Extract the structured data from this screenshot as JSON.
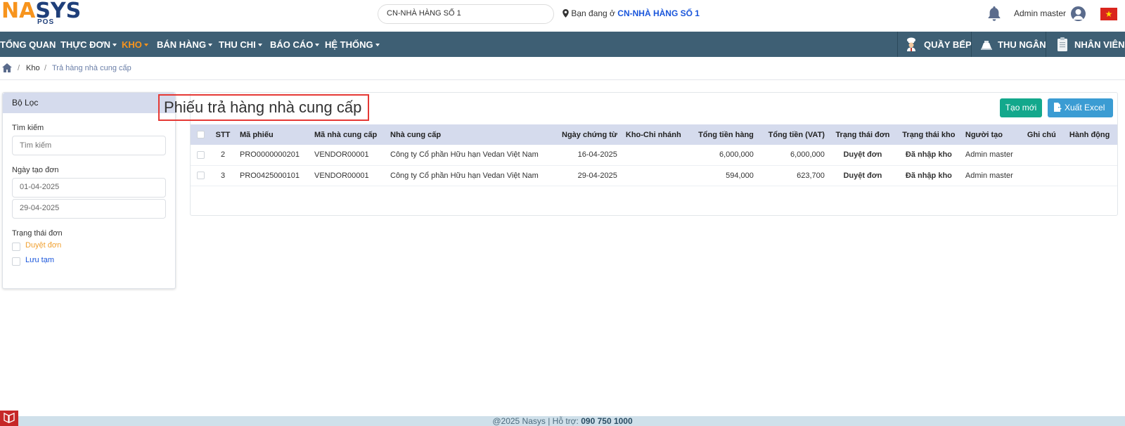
{
  "header": {
    "logo_main_na": "NA",
    "logo_main_sys": "SYS",
    "logo_sub": "POS",
    "branch_select_value": "CN-NHÀ HÀNG SỐ 1",
    "location_prefix": "Bạn đang ở",
    "location_branch": "CN-NHÀ HÀNG SỐ 1",
    "user_name": "Admin master",
    "flag_star": "★"
  },
  "nav": {
    "items": [
      {
        "label": "TỔNG QUAN"
      },
      {
        "label": "THỰC ĐƠN"
      },
      {
        "label": "KHO"
      },
      {
        "label": "BÁN HÀNG"
      },
      {
        "label": "THU CHI"
      },
      {
        "label": "BÁO CÁO"
      },
      {
        "label": "HỆ THỐNG"
      }
    ],
    "right": [
      {
        "label": "QUẦY BẾP"
      },
      {
        "label": "THU NGÂN"
      },
      {
        "label": "NHÂN VIÊN"
      }
    ],
    "active_color": "#f7941d"
  },
  "breadcrumb": {
    "sep": "/",
    "kho": "Kho",
    "current": "Trả hàng nhà cung cấp"
  },
  "filter": {
    "title": "Bộ Lọc",
    "search_label": "Tìm kiếm",
    "search_placeholder": "Tìm kiếm",
    "date_label": "Ngày tạo đơn",
    "date_from": "01-04-2025",
    "date_to": "29-04-2025",
    "status_label": "Trạng thái đơn",
    "status_options": [
      {
        "label": "Duyệt đơn",
        "color": "#f0a030"
      },
      {
        "label": "Lưu tạm",
        "color": "#1a56db"
      }
    ]
  },
  "main": {
    "title": "Phiếu trả hàng nhà cung cấp",
    "btn_new": "Tạo mới",
    "btn_excel": "Xuất Excel",
    "columns": [
      "STT",
      "Mã phiếu",
      "Mã nhà cung cấp",
      "Nhà cung cấp",
      "Ngày chứng từ",
      "Kho-Chi nhánh",
      "Tổng tiền hàng",
      "Tổng tiền (VAT)",
      "Trạng thái đơn",
      "Trạng thái kho",
      "Người tạo",
      "Ghi chú",
      "Hành động"
    ],
    "rows": [
      {
        "stt": "2",
        "code": "PRO0000000201",
        "vendor_code": "VENDOR00001",
        "vendor": "Công ty Cổ phần Hữu hạn Vedan Việt Nam",
        "date": "16-04-2025",
        "branch": "",
        "total": "6,000,000",
        "total_vat": "6,000,000",
        "order_status": "Duyệt đơn",
        "stock_status": "Đã nhập kho",
        "creator": "Admin master",
        "note": "",
        "action": ""
      },
      {
        "stt": "3",
        "code": "PRO0425000101",
        "vendor_code": "VENDOR00001",
        "vendor": "Công ty Cổ phần Hữu hạn Vedan Việt Nam",
        "date": "29-04-2025",
        "branch": "",
        "total": "594,000",
        "total_vat": "623,700",
        "order_status": "Duyệt đơn",
        "stock_status": "Đã nhập kho",
        "creator": "Admin master",
        "note": "",
        "action": ""
      }
    ]
  },
  "footer": {
    "text": "@2025 Nasys | Hỗ trợ:",
    "phone": "090 750 1000"
  }
}
